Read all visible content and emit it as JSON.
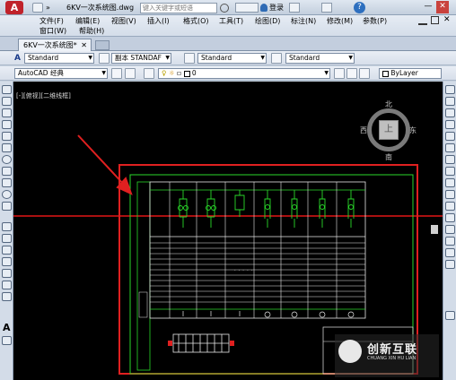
{
  "titlebar": {
    "logo": "A",
    "doc_title": "6KV一次系统图.dwg",
    "search_placeholder": "键入关键字或短语",
    "signin": "登录",
    "help": "?",
    "minimize": "—",
    "close": "✕"
  },
  "menu": {
    "row1": [
      "文件(F)",
      "编辑(E)",
      "视图(V)",
      "插入(I)",
      "格式(O)",
      "工具(T)",
      "绘图(D)",
      "标注(N)",
      "修改(M)",
      "参数(P)"
    ],
    "row2": [
      "窗口(W)",
      "帮助(H)"
    ]
  },
  "tabs": {
    "active": "6KV一次系统图*",
    "close": "✕"
  },
  "toolbar1": {
    "text_style": "Standard",
    "dim_style": "副本 STANDAF",
    "table_style": "Standard",
    "mleader_style": "Standard"
  },
  "toolbar2": {
    "workspace": "AutoCAD 经典",
    "layer": "0",
    "color": "ByLayer"
  },
  "viewport": {
    "label": "[-][俯视][二维线框]"
  },
  "viewcube": {
    "north": "北",
    "south": "南",
    "east": "东",
    "west": "西",
    "top": "上"
  },
  "drawing": {
    "cell_note": "- - - - -"
  },
  "watermark": {
    "name": "创新互联",
    "sub": "CHUANG XIN HU LIAN"
  }
}
